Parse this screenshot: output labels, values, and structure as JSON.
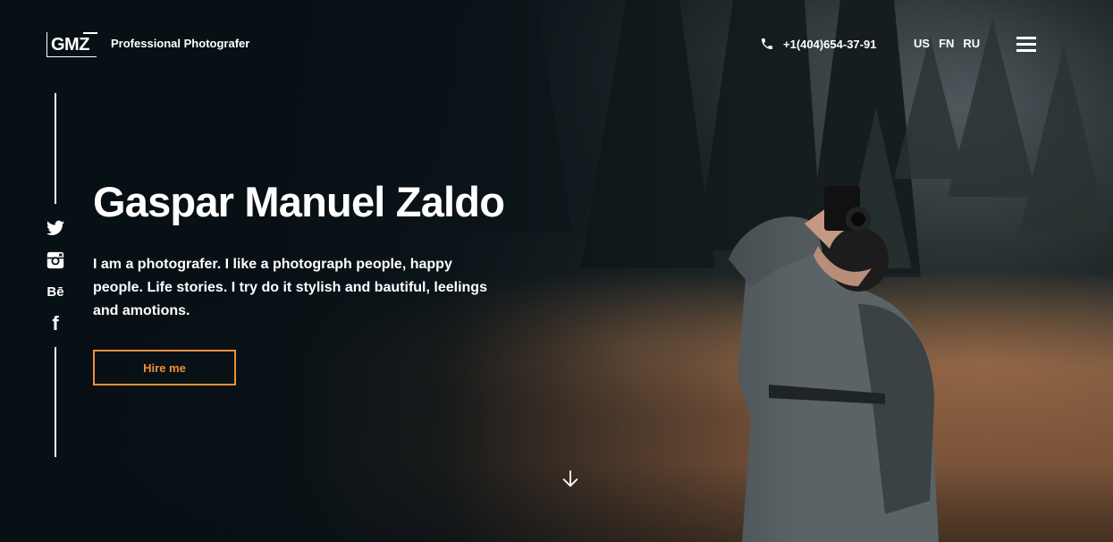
{
  "header": {
    "logo_text": "GMZ",
    "tagline": "Professional Photografer",
    "phone": "+1(404)654-37-91",
    "languages": [
      "US",
      "FN",
      "RU"
    ]
  },
  "social": {
    "icons": [
      "twitter-icon",
      "instagram-icon",
      "behance-icon",
      "facebook-icon"
    ],
    "behance_label": "Bē",
    "facebook_label": "f"
  },
  "hero": {
    "title": "Gaspar Manuel Zaldo",
    "description": "I am a photografer. I like a photograph people, happy people. Life stories. I try do it stylish and bautiful, leelings and amotions.",
    "button_label": "Hire me"
  },
  "colors": {
    "accent": "#f0903a",
    "background": "#0b1116",
    "text": "#ffffff"
  }
}
